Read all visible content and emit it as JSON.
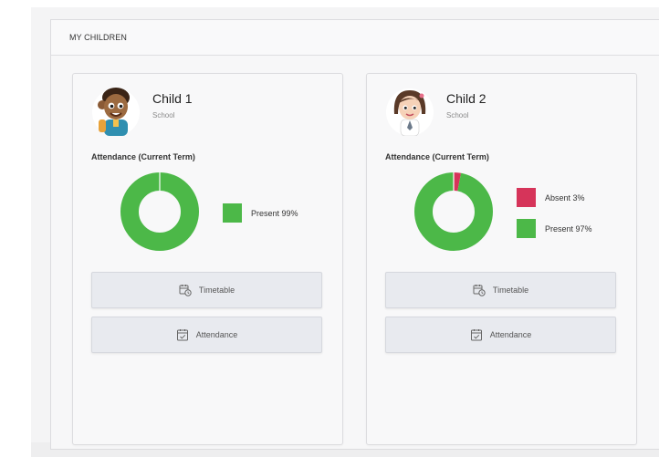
{
  "section": {
    "title": "MY CHILDREN"
  },
  "colors": {
    "present": "#4cb848",
    "absent": "#d6345a"
  },
  "children": [
    {
      "name": "Child 1",
      "school": "School",
      "attendance_title": "Attendance (Current Term)",
      "legend": [
        {
          "label": "Present 99%",
          "color": "#4cb848"
        }
      ],
      "chart_data": {
        "type": "pie",
        "categories": [
          "Present"
        ],
        "values": [
          99
        ]
      },
      "buttons": {
        "timetable": "Timetable",
        "attendance": "Attendance"
      }
    },
    {
      "name": "Child 2",
      "school": "School",
      "attendance_title": "Attendance (Current Term)",
      "legend": [
        {
          "label": "Absent 3%",
          "color": "#d6345a"
        },
        {
          "label": "Present 97%",
          "color": "#4cb848"
        }
      ],
      "chart_data": {
        "type": "pie",
        "categories": [
          "Absent",
          "Present"
        ],
        "values": [
          3,
          97
        ]
      },
      "buttons": {
        "timetable": "Timetable",
        "attendance": "Attendance"
      }
    }
  ],
  "icons": {
    "timetable": "calendar-clock-icon",
    "attendance": "calendar-check-icon"
  }
}
